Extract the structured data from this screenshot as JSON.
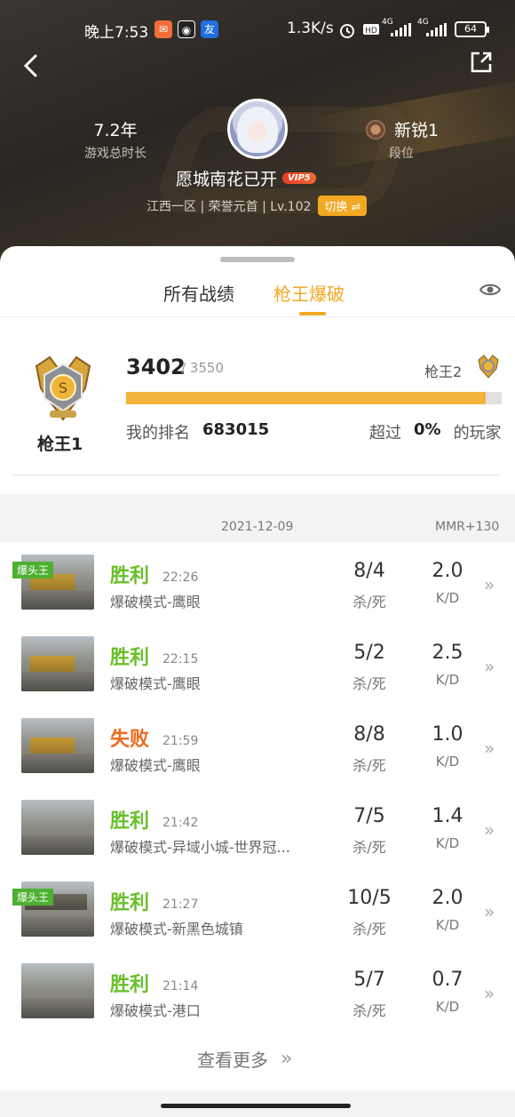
{
  "status_bar": {
    "time": "晚上7:53",
    "network_speed": "1.3K/s",
    "signal1": "4G",
    "signal2": "4G",
    "battery": "64",
    "app_icon_2_label": "友"
  },
  "header": {
    "play_time_value": "7.2年",
    "play_time_label": "游戏总时长",
    "rank_value": "新锐1",
    "rank_label": "段位",
    "username": "愿城南花已开",
    "vip_label": "VIP5",
    "server_info": "江西一区 | 荣誉元首 | Lv.102",
    "switch_label": "切换 ⇌"
  },
  "tabs": {
    "all": "所有战绩",
    "sniper": "枪王爆破"
  },
  "rank_panel": {
    "current_rank": "枪王1",
    "score": "3402",
    "score_max": "/ 3550",
    "progress_fraction": 0.958,
    "next_rank": "枪王2",
    "my_rank_label": "我的排名",
    "my_rank_value": "683015",
    "exceed_prefix": "超过",
    "exceed_value": "0%",
    "exceed_suffix": "的玩家"
  },
  "date_row": {
    "date": "2021-12-09",
    "mmr": "MMR+130"
  },
  "matches": [
    {
      "badge": "爆头王",
      "result": "胜利",
      "win": true,
      "time": "22:26",
      "mode": "爆破模式-鹰眼",
      "kd": "8/4",
      "kd_label": "杀/死",
      "ratio": "2.0",
      "ratio_label": "K/D"
    },
    {
      "badge": "",
      "result": "胜利",
      "win": true,
      "time": "22:15",
      "mode": "爆破模式-鹰眼",
      "kd": "5/2",
      "kd_label": "杀/死",
      "ratio": "2.5",
      "ratio_label": "K/D"
    },
    {
      "badge": "",
      "result": "失败",
      "win": false,
      "time": "21:59",
      "mode": "爆破模式-鹰眼",
      "kd": "8/8",
      "kd_label": "杀/死",
      "ratio": "1.0",
      "ratio_label": "K/D"
    },
    {
      "badge": "",
      "result": "胜利",
      "win": true,
      "time": "21:42",
      "mode": "爆破模式-异域小城-世界冠...",
      "kd": "7/5",
      "kd_label": "杀/死",
      "ratio": "1.4",
      "ratio_label": "K/D"
    },
    {
      "badge": "爆头王",
      "result": "胜利",
      "win": true,
      "time": "21:27",
      "mode": "爆破模式-新黑色城镇",
      "kd": "10/5",
      "kd_label": "杀/死",
      "ratio": "2.0",
      "ratio_label": "K/D"
    },
    {
      "badge": "",
      "result": "胜利",
      "win": true,
      "time": "21:14",
      "mode": "爆破模式-港口",
      "kd": "5/7",
      "kd_label": "杀/死",
      "ratio": "0.7",
      "ratio_label": "K/D"
    }
  ],
  "more_label": "查看更多",
  "colors": {
    "accent": "#f2a823",
    "win": "#6abf2a",
    "lose": "#ee6a1e",
    "badge": "#4db030"
  }
}
